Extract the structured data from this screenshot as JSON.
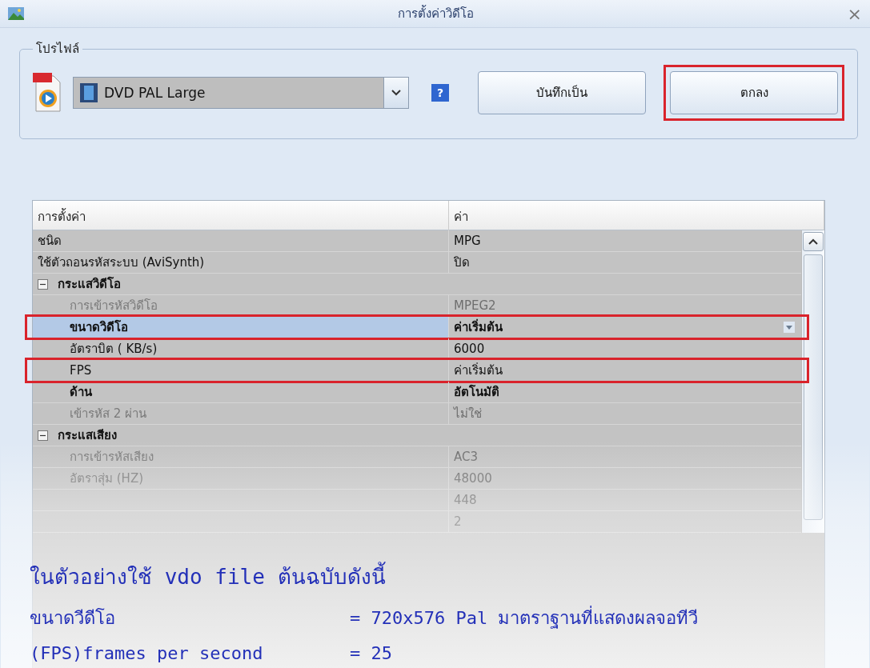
{
  "window": {
    "title": "การตั้งค่าวิดีโอ",
    "close": "×"
  },
  "profile": {
    "legend": "โปรไฟล์",
    "preset": "DVD PAL Large",
    "help": "?",
    "buttons": [
      {
        "label": "บันทึกเป็น",
        "highlighted": false
      },
      {
        "label": "ตกลง",
        "highlighted": true
      }
    ]
  },
  "grid": {
    "columns": [
      "การตั้งค่า",
      "ค่า"
    ],
    "rows": [
      {
        "kind": "setting",
        "label": "ชนิด",
        "value": "MPG",
        "disabled": false,
        "bold": false,
        "selected": false,
        "highlighted": false
      },
      {
        "kind": "setting",
        "label": "ใช้ตัวถอนรหัสระบบ (AviSynth)",
        "value": "ปิด",
        "disabled": false,
        "bold": false,
        "selected": false,
        "highlighted": false
      },
      {
        "kind": "group",
        "label": "กระแสวิดีโอ",
        "expanded": true,
        "children": [
          {
            "kind": "setting",
            "label": "การเข้ารหัสวิดีโอ",
            "value": "MPEG2",
            "disabled": true,
            "bold": false,
            "selected": false,
            "highlighted": false
          },
          {
            "kind": "setting",
            "label": "ขนาดวิดีโอ",
            "value": "ค่าเริ่มต้น",
            "disabled": false,
            "bold": true,
            "selected": true,
            "highlighted": true
          },
          {
            "kind": "setting",
            "label": "อัตราบิต ( KB/s)",
            "value": "6000",
            "disabled": false,
            "bold": false,
            "selected": false,
            "highlighted": false
          },
          {
            "kind": "setting",
            "label": "FPS",
            "value": "ค่าเริ่มต้น",
            "disabled": false,
            "bold": false,
            "selected": false,
            "highlighted": true
          },
          {
            "kind": "setting",
            "label": "ด้าน",
            "value": "อัตโนมัติ",
            "disabled": false,
            "bold": true,
            "selected": false,
            "highlighted": false
          },
          {
            "kind": "setting",
            "label": "เข้ารหัส 2 ผ่าน",
            "value": "ไม่ใช่",
            "disabled": true,
            "bold": false,
            "selected": false,
            "highlighted": false
          }
        ]
      },
      {
        "kind": "group",
        "label": "กระแสเสียง",
        "expanded": true,
        "children": [
          {
            "kind": "setting",
            "label": "การเข้ารหัสเสียง",
            "value": "AC3",
            "disabled": true,
            "bold": false,
            "selected": false,
            "highlighted": false
          },
          {
            "kind": "setting",
            "label": "อัตราสุ่ม (HZ)",
            "value": "48000",
            "disabled": true,
            "bold": false,
            "selected": false,
            "highlighted": false
          },
          {
            "kind": "setting",
            "value": "448",
            "disabled": true,
            "bold": false,
            "selected": false,
            "highlighted": false
          },
          {
            "kind": "setting",
            "value": "2",
            "disabled": true,
            "bold": false,
            "selected": false,
            "highlighted": false
          }
        ]
      }
    ]
  },
  "caption": {
    "intro": "ในตัวอย่างใช้ vdo file ต้นฉบับดังนี้",
    "lines": [
      {
        "name": "ขนาดวีดีโอ",
        "value": "= 720x576 Pal มาตราฐานที่แสดงผลจอทีวี"
      },
      {
        "name": "(FPS)frames per second",
        "value": "= 25"
      }
    ]
  }
}
